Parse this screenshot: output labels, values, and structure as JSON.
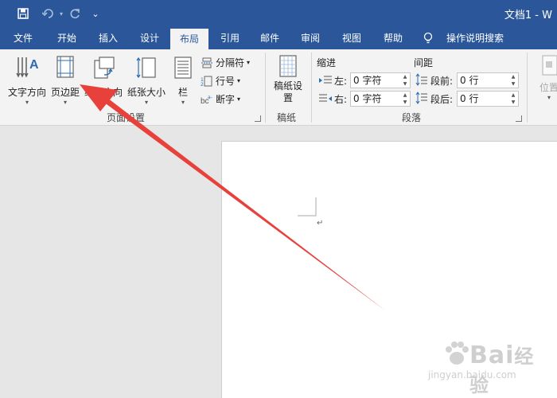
{
  "titlebar": {
    "title": "文档1 - W",
    "undo_icon": "undo-icon",
    "redo_icon": "redo-icon",
    "save_icon": "save-icon"
  },
  "tabs": [
    {
      "label": "文件"
    },
    {
      "label": "开始"
    },
    {
      "label": "插入"
    },
    {
      "label": "设计"
    },
    {
      "label": "布局"
    },
    {
      "label": "引用"
    },
    {
      "label": "邮件"
    },
    {
      "label": "审阅"
    },
    {
      "label": "视图"
    },
    {
      "label": "帮助"
    },
    {
      "label": "操作说明搜索"
    }
  ],
  "ribbon": {
    "page_setup": {
      "text_direction": "文字方向",
      "margins": "页边距",
      "orientation": "纸张方向",
      "size": "纸张大小",
      "columns": "栏",
      "breaks": "分隔符",
      "line_numbers": "行号",
      "hyphenation": "断字",
      "group_label": "页面设置"
    },
    "manuscript": {
      "button": "稿纸设置",
      "group_label": "稿纸"
    },
    "paragraph": {
      "indent_header": "缩进",
      "spacing_header": "间距",
      "left_label": "左:",
      "right_label": "右:",
      "left_value": "0 字符",
      "right_value": "0 字符",
      "before_label": "段前:",
      "after_label": "段后:",
      "before_value": "0 行",
      "after_value": "0 行",
      "group_label": "段落"
    },
    "arrange": {
      "position": "位置"
    }
  },
  "watermark": {
    "brand": "Bai",
    "brand2": "经验",
    "url": "jingyan.baidu.com"
  },
  "colors": {
    "accent": "#2b579a",
    "arrow": "#e8413c"
  }
}
